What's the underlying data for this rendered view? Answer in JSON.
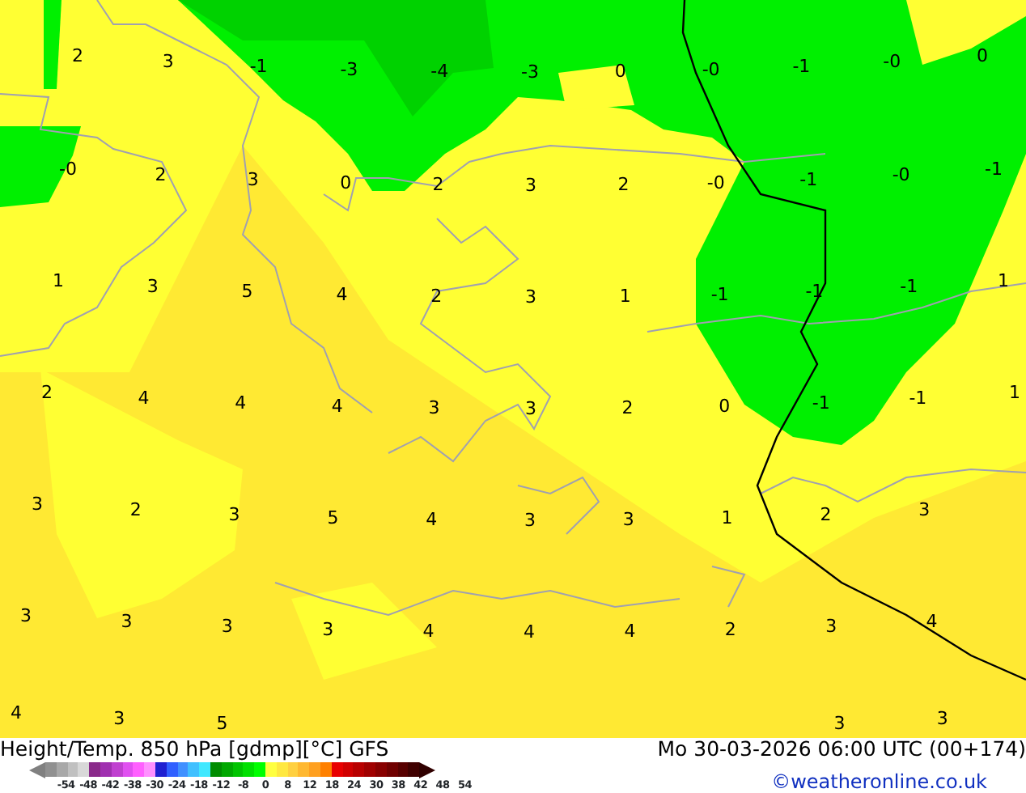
{
  "map": {
    "label_rows": [
      [
        "2",
        "3",
        "-1",
        "-3",
        "-4",
        "-3",
        "0",
        "-0",
        "-1",
        "-0",
        "0"
      ],
      [
        "-0",
        "2",
        "3",
        "0",
        "2",
        "3",
        "2",
        "-0",
        "-1",
        "-0",
        "-1"
      ],
      [
        "1",
        "3",
        "5",
        "4",
        "2",
        "3",
        "1",
        "-1",
        "-1",
        "-1",
        "1"
      ],
      [
        "2",
        "4",
        "4",
        "4",
        "3",
        "3",
        "2",
        "0",
        "-1",
        "-1",
        "1"
      ],
      [
        "3",
        "2",
        "3",
        "5",
        "4",
        "3",
        "3",
        "1",
        "2",
        "3",
        null
      ],
      [
        "3",
        "3",
        "3",
        "3",
        "4",
        "4",
        "4",
        "2",
        "3",
        "4",
        null
      ],
      [
        "4",
        "3",
        "5",
        null,
        null,
        null,
        null,
        null,
        "3",
        "3",
        null
      ]
    ]
  },
  "caption": {
    "title": "Height/Temp. 850 hPa [gdmp][°C] GFS",
    "datetime": "Mo 30-03-2026 06:00 UTC (00+174)",
    "credit": "©weatheronline.co.uk"
  },
  "color_scale": {
    "ticks": [
      "-54",
      "-48",
      "-42",
      "-38",
      "-30",
      "-24",
      "-18",
      "-12",
      "-8",
      "0",
      "8",
      "12",
      "18",
      "24",
      "30",
      "38",
      "42",
      "48",
      "54"
    ]
  }
}
